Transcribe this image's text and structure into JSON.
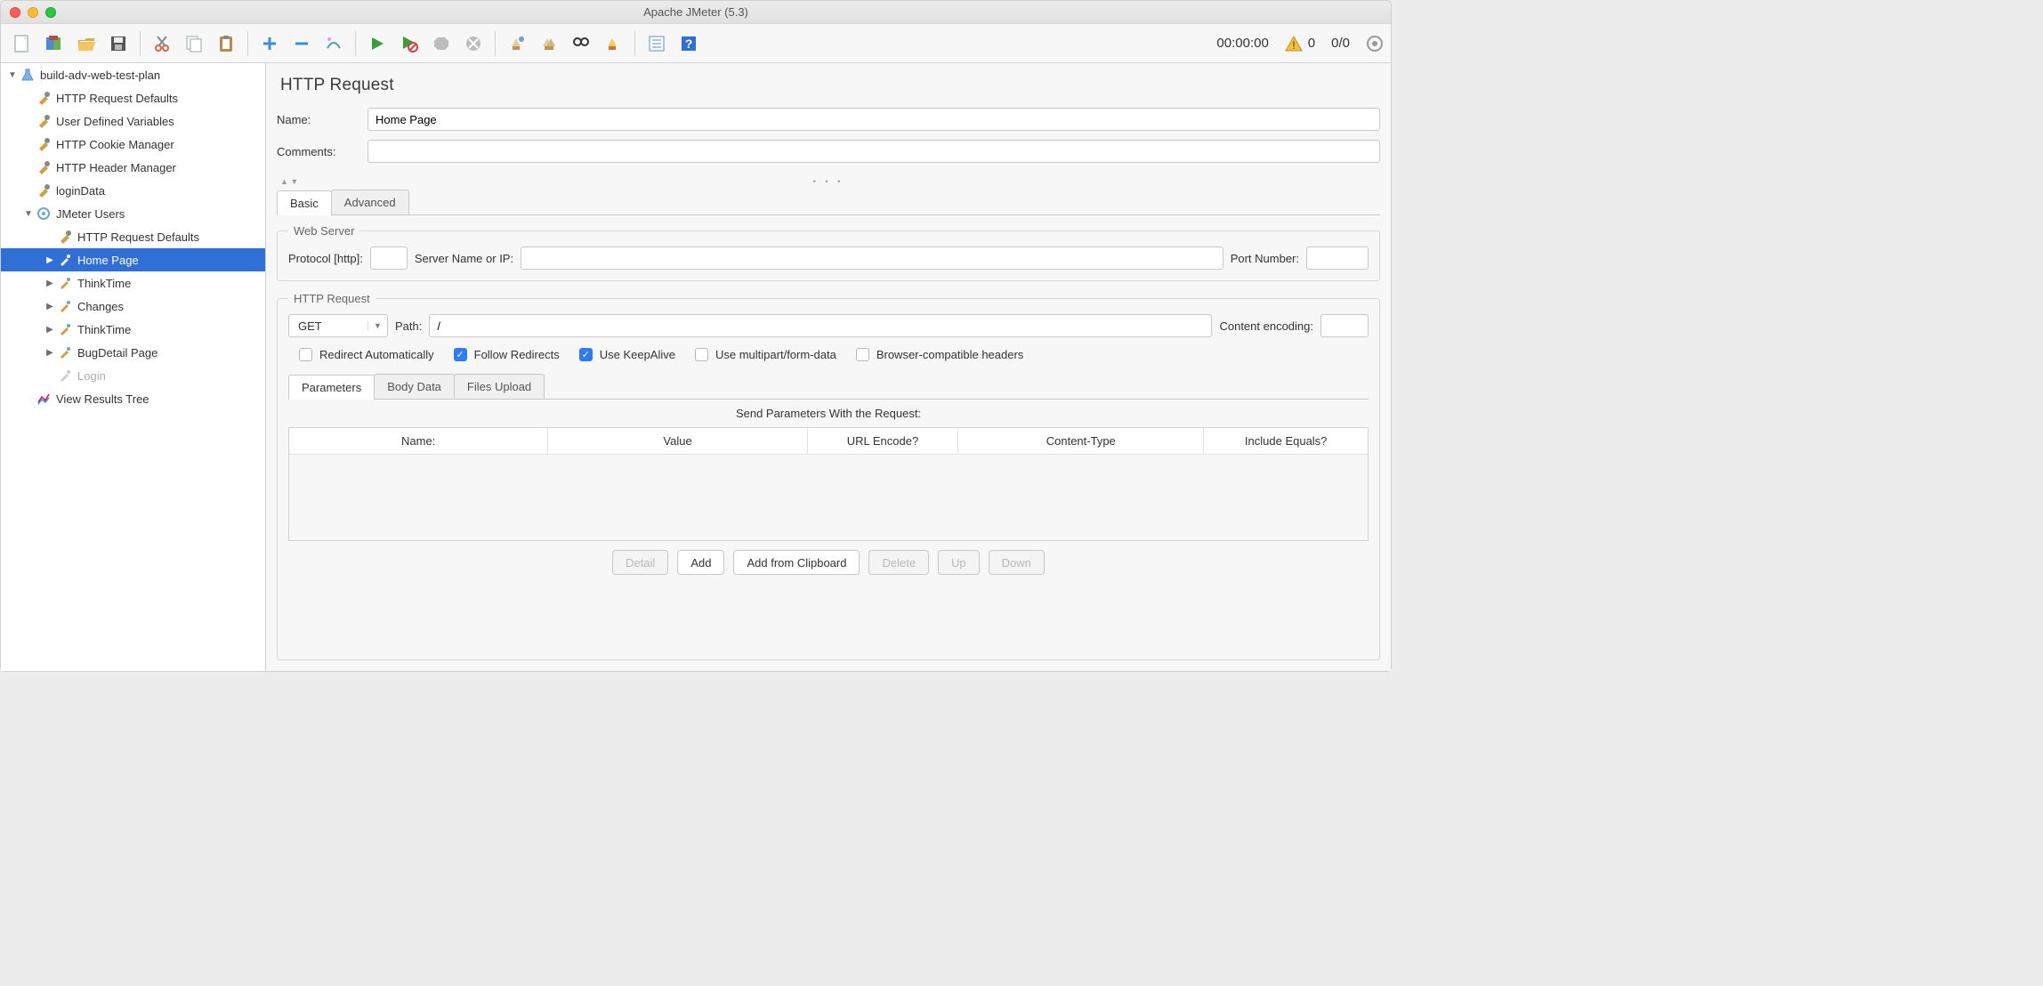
{
  "window": {
    "title": "Apache JMeter (5.3)"
  },
  "toolbar_status": {
    "time": "00:00:00",
    "warn_count": "0",
    "thread_count": "0/0"
  },
  "tree": {
    "root": "build-adv-web-test-plan",
    "items": [
      {
        "label": "HTTP Request Defaults"
      },
      {
        "label": "User Defined Variables"
      },
      {
        "label": "HTTP Cookie Manager"
      },
      {
        "label": "HTTP Header Manager"
      },
      {
        "label": "loginData"
      }
    ],
    "group": "JMeter Users",
    "group_items": [
      {
        "label": "HTTP Request Defaults"
      },
      {
        "label": "Home Page",
        "selected": true
      },
      {
        "label": "ThinkTime"
      },
      {
        "label": "Changes"
      },
      {
        "label": "ThinkTime"
      },
      {
        "label": "BugDetail Page"
      },
      {
        "label": "Login",
        "disabled": true
      }
    ],
    "last": "View Results Tree"
  },
  "panel": {
    "title": "HTTP Request",
    "name_label": "Name:",
    "name_value": "Home Page",
    "comments_label": "Comments:",
    "comments_value": "",
    "tabs": {
      "basic": "Basic",
      "advanced": "Advanced"
    },
    "webserver": {
      "legend": "Web Server",
      "protocol_label": "Protocol [http]:",
      "protocol_value": "",
      "server_label": "Server Name or IP:",
      "server_value": "",
      "port_label": "Port Number:",
      "port_value": ""
    },
    "http": {
      "legend": "HTTP Request",
      "method": "GET",
      "path_label": "Path:",
      "path_value": "/",
      "encoding_label": "Content encoding:",
      "encoding_value": "",
      "redirect_auto": "Redirect Automatically",
      "follow_redirects": "Follow Redirects",
      "keepalive": "Use KeepAlive",
      "multipart": "Use multipart/form-data",
      "browser_headers": "Browser-compatible headers"
    },
    "subtabs": {
      "params": "Parameters",
      "body": "Body Data",
      "files": "Files Upload"
    },
    "params_table": {
      "title": "Send Parameters With the Request:",
      "cols": {
        "name": "Name:",
        "value": "Value",
        "enc": "URL Encode?",
        "ct": "Content-Type",
        "eq": "Include Equals?"
      }
    },
    "buttons": {
      "detail": "Detail",
      "add": "Add",
      "clip": "Add from Clipboard",
      "delete": "Delete",
      "up": "Up",
      "down": "Down"
    }
  }
}
